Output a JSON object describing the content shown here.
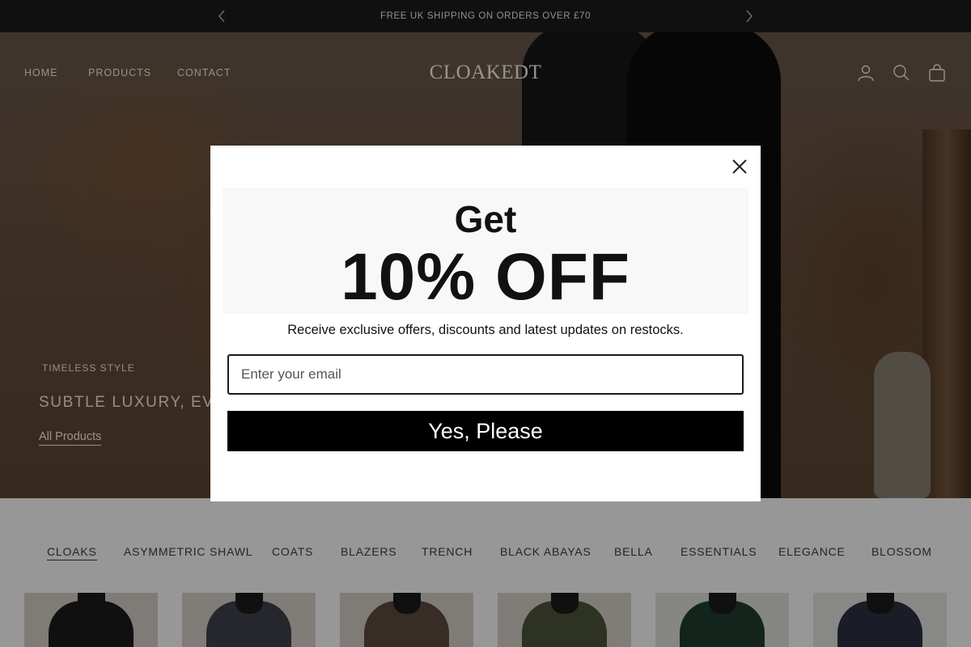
{
  "announcement": {
    "text": "FREE UK SHIPPING ON ORDERS OVER £70",
    "prev_icon": "chevron-left-icon",
    "next_icon": "chevron-right-icon"
  },
  "header": {
    "logo": "CLOAKEDT",
    "nav": [
      "HOME",
      "PRODUCTS",
      "CONTACT"
    ],
    "icons": [
      "account-icon",
      "search-icon",
      "bag-icon"
    ]
  },
  "hero": {
    "subtitle": "TIMELESS STYLE",
    "title": "SUBTLE LUXURY, EVERY",
    "link": "All Products"
  },
  "categories": {
    "items": [
      "CLOAKS",
      "ASYMMETRIC SHAWL",
      "COATS",
      "BLAZERS",
      "TRENCH",
      "BLACK ABAYAS",
      "BELLA",
      "ESSENTIALS",
      "ELEGANCE",
      "BLOSSOM"
    ],
    "active": "CLOAKS"
  },
  "products": {
    "colors": [
      "#1b1b1b",
      "#3c4048",
      "#5a4a3e",
      "#4a5138",
      "#1f3a30",
      "#2b3040"
    ]
  },
  "popup": {
    "heading_small": "Get",
    "heading_large": "10% OFF",
    "description": "Receive exclusive offers, discounts and latest updates on restocks.",
    "email_placeholder": "Enter your email",
    "submit_label": "Yes, Please",
    "close_icon": "close-icon"
  },
  "colors": {
    "announcement_bg": "#1b1b1b",
    "button_bg": "#000000",
    "page_bg": "#f4f4f4"
  }
}
